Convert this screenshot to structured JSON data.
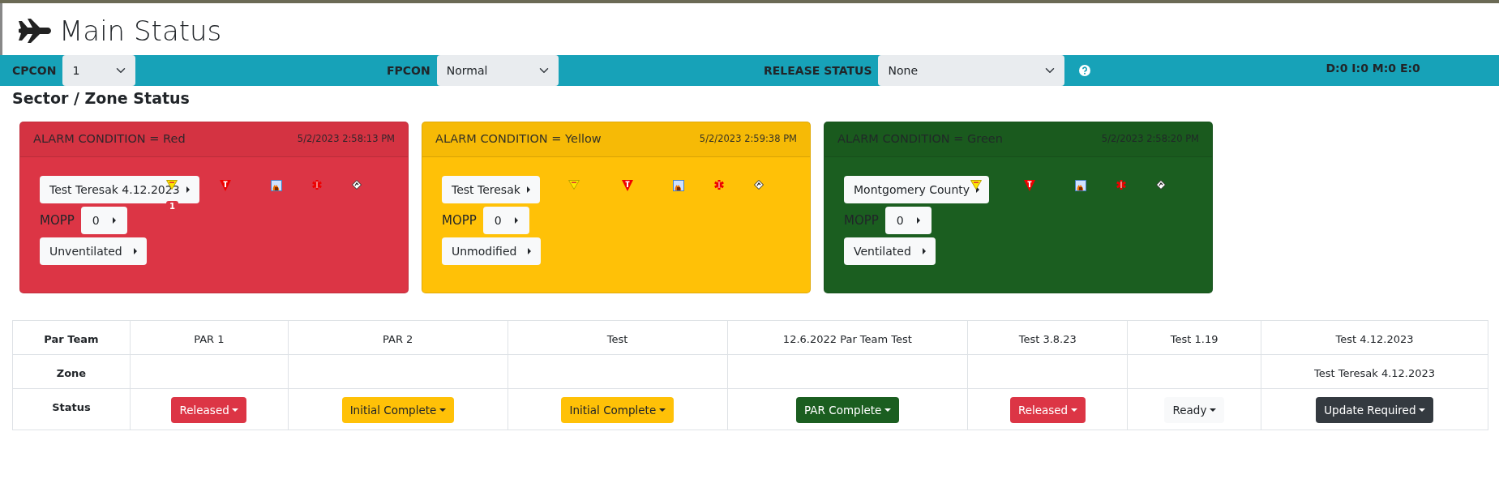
{
  "header": {
    "title": "Main Status"
  },
  "toolbar": {
    "fields": [
      {
        "label": "CPCON",
        "value": "1"
      },
      {
        "label": "FPCON",
        "value": "Normal"
      },
      {
        "label": "RELEASE STATUS",
        "value": "None"
      }
    ],
    "counts": "D:0 I:0 M:0 E:0"
  },
  "section_title": "Sector / Zone Status",
  "zones": [
    {
      "alarm": "ALARM CONDITION = Red",
      "color": "#dc3545",
      "time": "5/2/2023 2:58:13 PM",
      "zone": "Test Teresak 4.12.2023",
      "badge": "1",
      "mopp_label": "MOPP",
      "mopp": "0",
      "ventilation": "Unventilated"
    },
    {
      "alarm": "ALARM CONDITION = Yellow",
      "color": "#ffc107",
      "time": "5/2/2023 2:59:38 PM",
      "zone": "Test Teresak",
      "mopp_label": "MOPP",
      "mopp": "0",
      "ventilation": "Unmodified"
    },
    {
      "alarm": "ALARM CONDITION = Green",
      "color": "#1b5e20",
      "time": "5/2/2023 2:58:20 PM",
      "zone": "Montgomery County",
      "mopp_label": "MOPP",
      "mopp": "0",
      "ventilation": "Ventilated"
    }
  ],
  "table": {
    "row_labels": [
      "Par Team",
      "Zone",
      "Status"
    ],
    "teams": [
      {
        "name": "PAR 1",
        "status": "Released",
        "color": "#dc3545"
      },
      {
        "name": "PAR 2",
        "status": "Initial Complete",
        "color": "#ffc107"
      },
      {
        "name": "Test",
        "status": "Initial Complete",
        "color": "#ffc107"
      },
      {
        "name": "12.6.2022 Par Team Test",
        "status": "PAR Complete",
        "color": "#1b5e20"
      },
      {
        "name": "Test 3.8.23",
        "status": "Released",
        "color": "#dc3545"
      },
      {
        "name": "Test 1.19",
        "status": "Ready",
        "color": "#f8f9fa"
      },
      {
        "name": "Test 4.12.2023",
        "zone": "Test Teresak 4.12.2023",
        "status": "Update Required",
        "color": "#343a40"
      }
    ]
  }
}
